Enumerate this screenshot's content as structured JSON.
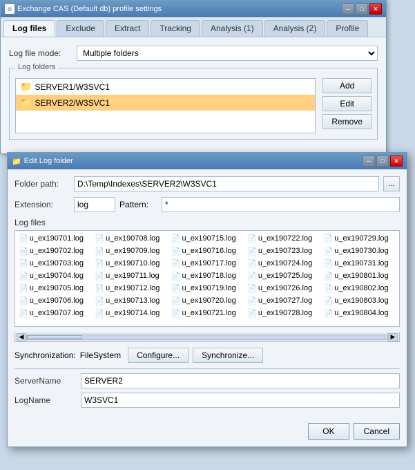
{
  "main_window": {
    "title": "Exchange CAS (Default db) profile settings",
    "tabs": [
      "Log files",
      "Exclude",
      "Extract",
      "Tracking",
      "Analysis (1)",
      "Analysis (2)",
      "Profile"
    ],
    "active_tab": "Log files",
    "log_file_mode_label": "Log file mode:",
    "log_file_mode_value": "Multiple folders",
    "log_folders_label": "Log folders",
    "folders": [
      {
        "name": "SERVER1/W3SVC1",
        "selected": false
      },
      {
        "name": "SERVER2/W3SVC1",
        "selected": true
      }
    ],
    "btn_add": "Add",
    "btn_edit": "Edit",
    "btn_remove": "Remove"
  },
  "dialog": {
    "title": "Edit Log folder",
    "folder_path_label": "Folder path:",
    "folder_path_value": "D:\\Temp\\Indexes\\SERVER2\\W3SVC1",
    "browse_label": "...",
    "extension_label": "Extension:",
    "extension_value": "log",
    "pattern_label": "Pattern:",
    "pattern_value": "*",
    "log_files_label": "Log files",
    "log_files": [
      "u_ex190701.log",
      "u_ex190708.log",
      "u_ex190715.log",
      "u_ex190722.log",
      "u_ex190729.log",
      "u_ex190702.log",
      "u_ex190709.log",
      "u_ex190716.log",
      "u_ex190723.log",
      "u_ex190730.log",
      "u_ex190703.log",
      "u_ex190710.log",
      "u_ex190717.log",
      "u_ex190724.log",
      "u_ex190731.log",
      "u_ex190704.log",
      "u_ex190711.log",
      "u_ex190718.log",
      "u_ex190725.log",
      "u_ex190801.log",
      "u_ex190705.log",
      "u_ex190712.log",
      "u_ex190719.log",
      "u_ex190726.log",
      "u_ex190802.log",
      "u_ex190706.log",
      "u_ex190713.log",
      "u_ex190720.log",
      "u_ex190727.log",
      "u_ex190803.log",
      "u_ex190707.log",
      "u_ex190714.log",
      "u_ex190721.log",
      "u_ex190728.log",
      "u_ex190804.log"
    ],
    "sync_label": "Synchronization:",
    "sync_value": "FileSystem",
    "btn_configure": "Configure...",
    "btn_synchronize": "Synchronize...",
    "server_name_label": "ServerName",
    "server_name_value": "SERVER2",
    "log_name_label": "LogName",
    "log_name_value": "W3SVC1",
    "btn_ok": "OK",
    "btn_cancel": "Cancel"
  }
}
